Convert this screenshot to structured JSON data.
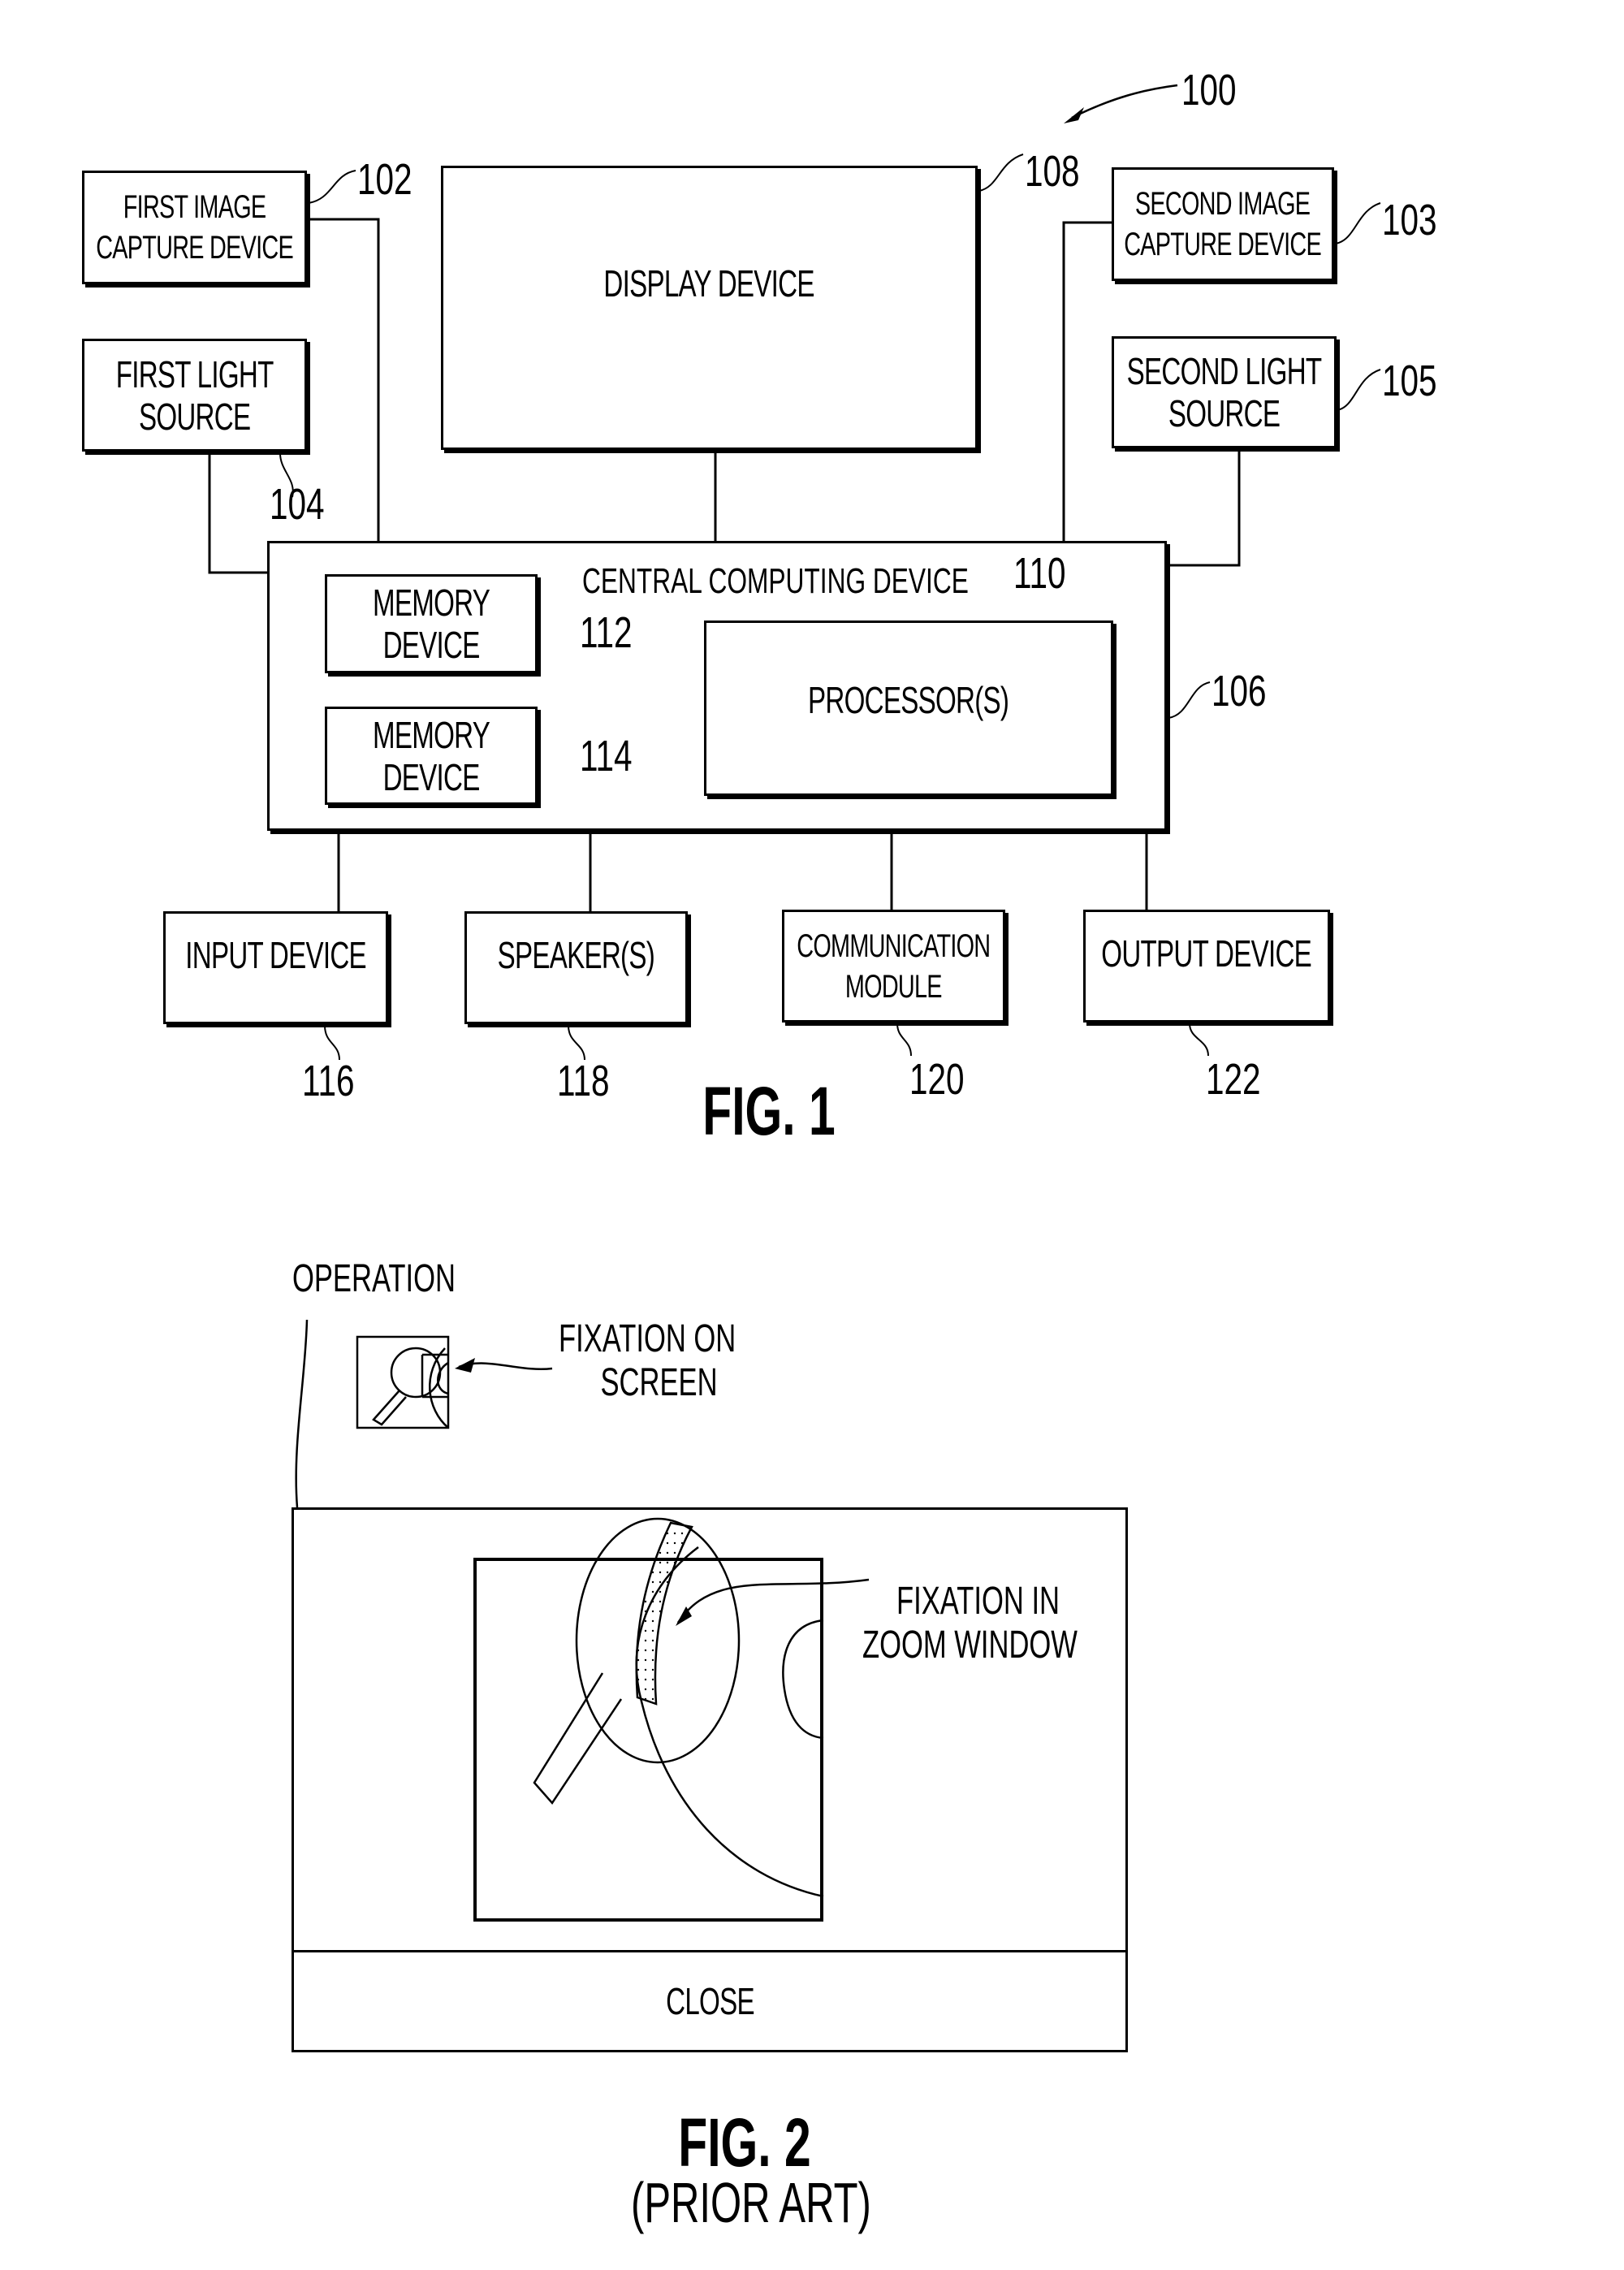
{
  "figure1": {
    "system_ref": "100",
    "caption": "FIG. 1",
    "blocks": {
      "first_image_capture": {
        "label_lines": [
          "FIRST IMAGE",
          "CAPTURE DEVICE"
        ],
        "ref": "102"
      },
      "second_image_capture": {
        "label_lines": [
          "SECOND IMAGE",
          "CAPTURE DEVICE"
        ],
        "ref": "103"
      },
      "first_light_source": {
        "label_lines": [
          "FIRST LIGHT",
          "SOURCE"
        ],
        "ref": "104"
      },
      "second_light_source": {
        "label_lines": [
          "SECOND LIGHT",
          "SOURCE"
        ],
        "ref": "105"
      },
      "display_device": {
        "label": "DISPLAY DEVICE",
        "ref": "108"
      },
      "central_computing_device": {
        "label": "CENTRAL COMPUTING DEVICE",
        "ref": "106"
      },
      "processor": {
        "label": "PROCESSOR(S)",
        "ref": "110"
      },
      "memory_device_1": {
        "label_lines": [
          "MEMORY",
          "DEVICE"
        ],
        "ref": "112"
      },
      "memory_device_2": {
        "label_lines": [
          "MEMORY",
          "DEVICE"
        ],
        "ref": "114"
      },
      "input_device": {
        "label": "INPUT DEVICE",
        "ref": "116"
      },
      "speakers": {
        "label": "SPEAKER(S)",
        "ref": "118"
      },
      "communication_module": {
        "label_lines": [
          "COMMUNICATION",
          "MODULE"
        ],
        "ref": "120"
      },
      "output_device": {
        "label": "OUTPUT DEVICE",
        "ref": "122"
      }
    }
  },
  "figure2": {
    "caption": "FIG. 2",
    "subcaption": "(PRIOR ART)",
    "operation_label": "OPERATION",
    "fixation_on_screen_lines": [
      "FIXATION ON",
      "SCREEN"
    ],
    "fixation_in_zoom_lines": [
      "FIXATION IN",
      "ZOOM WINDOW"
    ],
    "close_button": "CLOSE"
  }
}
